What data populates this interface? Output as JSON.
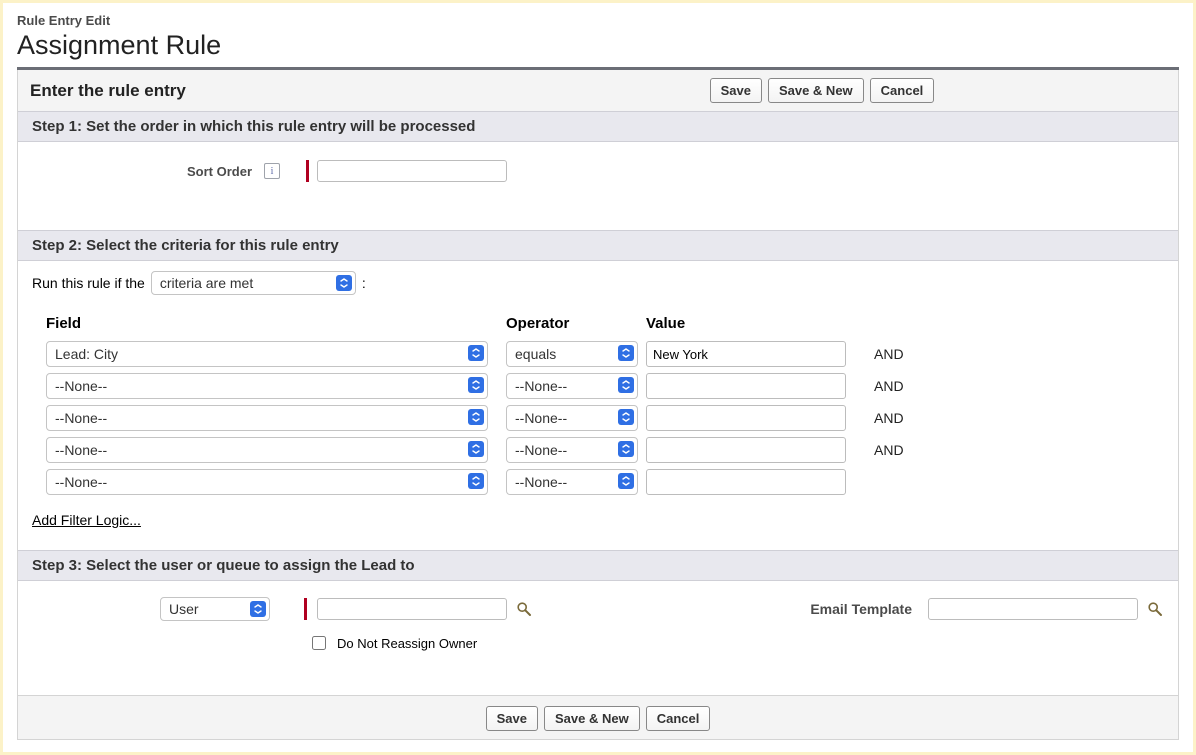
{
  "breadcrumb": "Rule Entry Edit",
  "page_title": "Assignment Rule",
  "header": {
    "title": "Enter the rule entry",
    "save_label": "Save",
    "save_new_label": "Save & New",
    "cancel_label": "Cancel"
  },
  "step1": {
    "header": "Step 1: Set the order in which this rule entry will be processed",
    "sort_label": "Sort Order",
    "info_tooltip": "i",
    "sort_value": ""
  },
  "step2": {
    "header": "Step 2: Select the criteria for this rule entry",
    "run_prefix": "Run this rule if the",
    "run_mode_selected": "criteria are met",
    "run_suffix": ":",
    "columns": {
      "field": "Field",
      "operator": "Operator",
      "value": "Value"
    },
    "join_label": "AND",
    "rows": [
      {
        "field": "Lead: City",
        "operator": "equals",
        "value": "New York",
        "show_join": true
      },
      {
        "field": "--None--",
        "operator": "--None--",
        "value": "",
        "show_join": true
      },
      {
        "field": "--None--",
        "operator": "--None--",
        "value": "",
        "show_join": true
      },
      {
        "field": "--None--",
        "operator": "--None--",
        "value": "",
        "show_join": true
      },
      {
        "field": "--None--",
        "operator": "--None--",
        "value": "",
        "show_join": false
      }
    ],
    "add_logic_label": "Add Filter Logic..."
  },
  "step3": {
    "header": "Step 3: Select the user or queue to assign the Lead to",
    "assign_type_selected": "User",
    "assign_value": "",
    "email_template_label": "Email Template",
    "email_template_value": "",
    "do_not_reassign_label": "Do Not Reassign Owner",
    "do_not_reassign_checked": false
  },
  "footer": {
    "save_label": "Save",
    "save_new_label": "Save & New",
    "cancel_label": "Cancel"
  }
}
